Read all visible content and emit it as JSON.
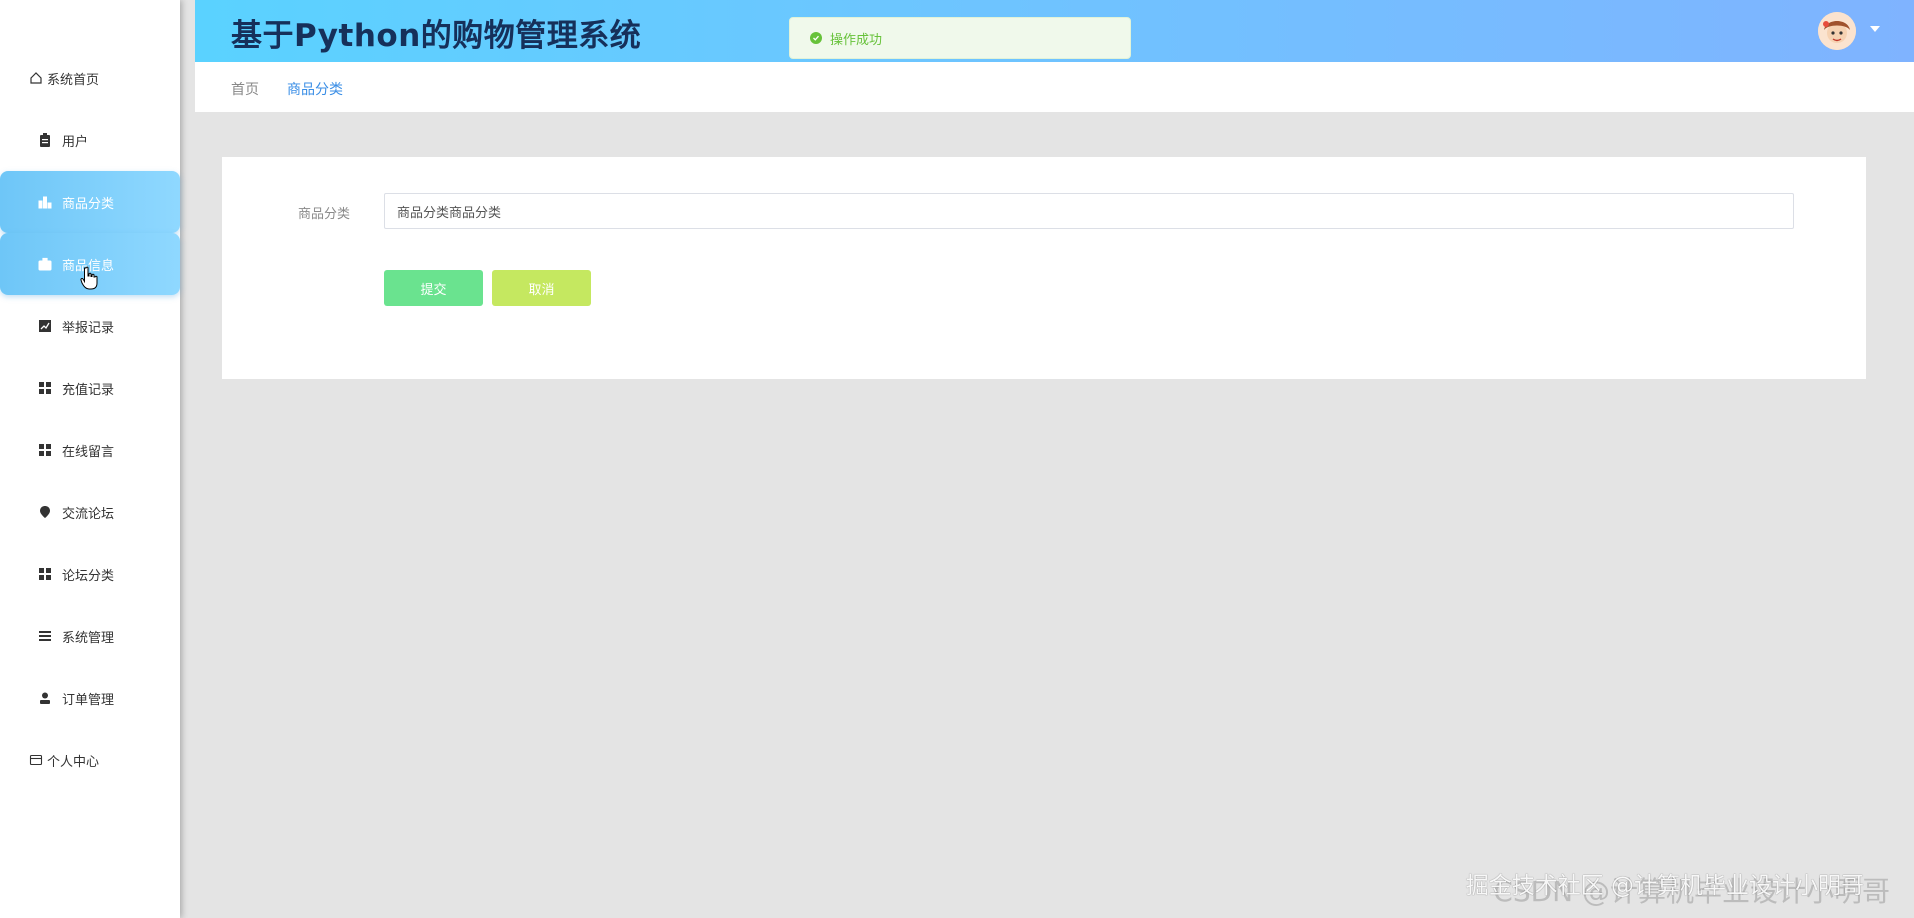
{
  "header": {
    "title": "基于Python的购物管理系统"
  },
  "toast": {
    "message": "操作成功",
    "color": "#67c23a"
  },
  "sidebar": {
    "items": [
      {
        "label": "系统首页",
        "icon": "home-outline-icon"
      },
      {
        "label": "用户",
        "icon": "clipboard-icon"
      },
      {
        "label": "商品分类",
        "icon": "bar-chart-icon",
        "active": true
      },
      {
        "label": "商品信息",
        "icon": "briefcase-icon",
        "active": true
      },
      {
        "label": "举报记录",
        "icon": "line-chart-icon"
      },
      {
        "label": "充值记录",
        "icon": "grid-icon"
      },
      {
        "label": "在线留言",
        "icon": "grid-icon"
      },
      {
        "label": "交流论坛",
        "icon": "map-pin-icon"
      },
      {
        "label": "论坛分类",
        "icon": "grid-icon"
      },
      {
        "label": "系统管理",
        "icon": "list-icon"
      },
      {
        "label": "订单管理",
        "icon": "user-icon"
      },
      {
        "label": "个人中心",
        "icon": "wallet-outline-icon"
      }
    ]
  },
  "breadcrumb": {
    "home": "首页",
    "current": "商品分类"
  },
  "form": {
    "field_label": "商品分类",
    "field_value": "商品分类商品分类",
    "submit_label": "提交",
    "cancel_label": "取消"
  },
  "watermark": {
    "back": "CSDN @计算机毕业设计小明哥",
    "front": "掘金技术社区 @计算机毕业设计小明哥"
  },
  "colors": {
    "accent": "#6ec6f7",
    "header_start": "#5ad2ff",
    "header_end": "#7fb3ff",
    "submit": "#6ae38f",
    "cancel": "#c5e860"
  }
}
